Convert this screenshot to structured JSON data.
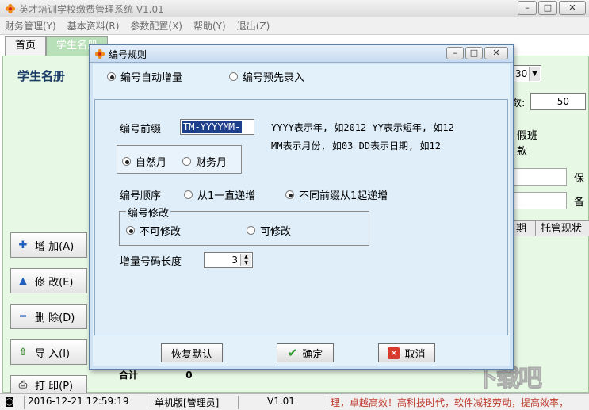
{
  "app": {
    "title": "英才培训学校缴费管理系统 V1.01",
    "menu": [
      "财务管理(Y)",
      "基本资料(R)",
      "参数配置(X)",
      "帮助(Y)",
      "退出(Z)"
    ],
    "tabs": [
      "首页",
      "学生名册"
    ],
    "active_tab": 1,
    "page_heading": "学生名册",
    "side_buttons": [
      {
        "label": "增 加(A)",
        "icon": "plus-icon"
      },
      {
        "label": "修 改(E)",
        "icon": "triangle-up-icon"
      },
      {
        "label": "删 除(D)",
        "icon": "minus-icon"
      },
      {
        "label": "导 入(I)",
        "icon": "import-icon"
      },
      {
        "label": "打 印(P)",
        "icon": "printer-icon"
      }
    ],
    "background": {
      "select_value": "30",
      "count_label": "数:",
      "count_value": "50",
      "vacation_label": "假班",
      "fee_label": "款",
      "field_label_1": "保",
      "field_label_2": "备",
      "col_partial": "期",
      "col_status": "托管现状",
      "sum_label": "合计",
      "sum_value": "0"
    },
    "status": {
      "datetime": "2016-12-21 12:59:19",
      "mode": "单机版[管理员]",
      "version": "V1.01",
      "marquee": "理，卓越高效！高科技时代，软件减轻劳动，提高效率，"
    },
    "watermark": "下载吧"
  },
  "dialog": {
    "title": "编号规则",
    "mode_auto": "编号自动增量",
    "mode_pre": "编号预先录入",
    "mode_selected": "auto",
    "prefix_label": "编号前缀",
    "prefix_value": "TM-YYYYMM-",
    "hint_line1": "YYYY表示年, 如2012 YY表示短年, 如12",
    "hint_line2": "MM表示月份, 如03  DD表示日期, 如12",
    "month_natural": "自然月",
    "month_fiscal": "财务月",
    "month_selected": "natural",
    "order_label": "编号顺序",
    "order_continuous": "从1一直递增",
    "order_per_prefix": "不同前缀从1起递增",
    "order_selected": "per_prefix",
    "modify_group": "编号修改",
    "modify_no": "不可修改",
    "modify_yes": "可修改",
    "modify_selected": "no",
    "length_label": "增量号码长度",
    "length_value": "3",
    "btn_reset": "恢复默认",
    "btn_ok": "确定",
    "btn_cancel": "取消"
  }
}
